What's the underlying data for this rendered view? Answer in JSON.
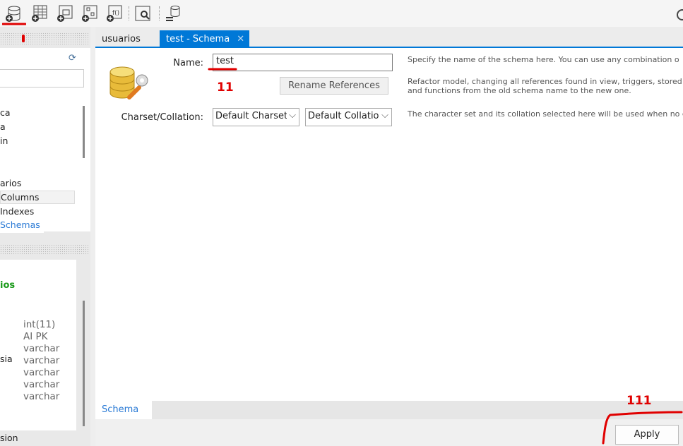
{
  "toolbar": {
    "icons": [
      "new-schema-icon",
      "new-table-icon",
      "new-view-icon",
      "new-routine-icon",
      "new-function-icon",
      "inspector-icon",
      "sync-db-icon",
      "settings-icon"
    ]
  },
  "left": {
    "tree_items": [
      "ca",
      "a",
      "in",
      "arios",
      "Columns",
      "Indexes"
    ],
    "schemas_tab": "Schemas",
    "info_title": "ios",
    "info_label": "sia",
    "info_types": [
      "int(11)",
      "AI PK",
      "varchar",
      "varchar",
      "varchar",
      "varchar",
      "varchar"
    ],
    "bottom_tab": "sion"
  },
  "tabs": [
    {
      "label": "usuarios"
    },
    {
      "label": "test - Schema",
      "active": true
    }
  ],
  "form": {
    "name_label": "Name:",
    "name_value": "test",
    "rename_button": "Rename References",
    "charset_label": "Charset/Collation:",
    "charset_value": "Default Charset",
    "collation_value": "Default Collation",
    "help_name": "Specify the name of the schema here. You can use any combination o",
    "help_refactor_1": "Refactor model, changing all references found in view, triggers, stored proce",
    "help_refactor_2": "and functions from the old schema name to the new one.",
    "help_charset": "The character set and its collation selected here will be used when no c"
  },
  "bottom_tab": "Schema",
  "apply_button": "Apply",
  "annotations": {
    "mark_1": "11",
    "mark_2": "111"
  },
  "colors": {
    "accent": "#0078d7",
    "annotation": "#e00000",
    "green": "#1a9a1a",
    "link": "#2a7ad5"
  }
}
